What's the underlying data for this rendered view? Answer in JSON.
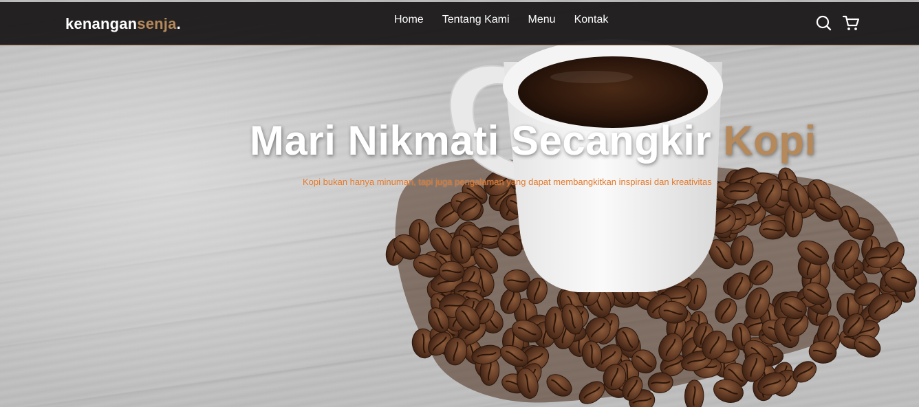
{
  "brand": {
    "name_main": "kenangan",
    "name_accent": "senja",
    "name_dot": "."
  },
  "nav": {
    "links": [
      {
        "label": "Home"
      },
      {
        "label": "Tentang Kami"
      },
      {
        "label": "Menu"
      },
      {
        "label": "Kontak"
      }
    ],
    "icons": [
      "search-icon",
      "shopping-cart-icon"
    ]
  },
  "hero": {
    "title_main": "Mari Nikmati Secangkir ",
    "title_accent": "Kopi",
    "subtitle": "Kopi bukan hanya minuman, tapi juga pengalaman yang dapat membangkitkan inspirasi dan kreativitas"
  },
  "colors": {
    "navbar_bg": "#161414",
    "accent": "#b6895b",
    "subtitle": "#e2782a",
    "nav_text": "#ffffff"
  }
}
